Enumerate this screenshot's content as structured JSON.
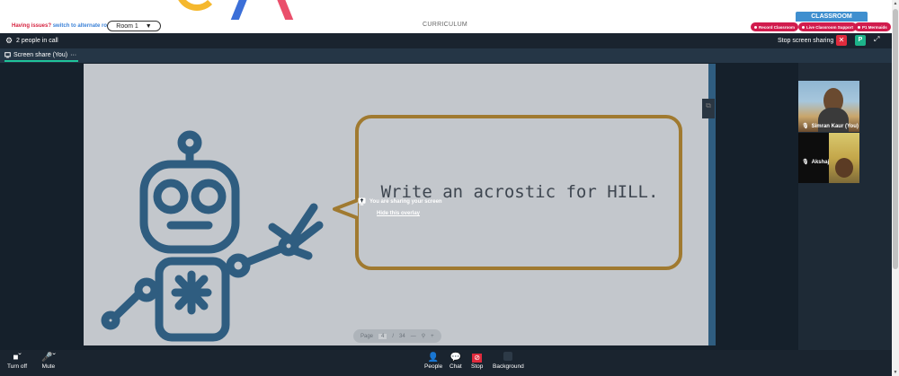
{
  "topbar": {
    "issues_text": "Having issues?",
    "alt_room_link": "switch to alternate room",
    "room_selected": "Room 1",
    "room_caret": "▼",
    "curriculum": "CURRICULUM",
    "classroom_tab": "CLASSROOM",
    "pills": [
      "Record Classroom",
      "Live Classroom Support",
      "P1 Mermaids"
    ]
  },
  "callbar": {
    "people_count": "2 people in call",
    "stop_sharing": "Stop screen sharing",
    "stop_x": "✕",
    "p_label": "P"
  },
  "tab": {
    "label": "Screen share (You)",
    "more": "···"
  },
  "slide": {
    "text": "Write an acrostic for HILL.",
    "pager_page_label": "Page",
    "pager_page": "4",
    "pager_sep": "/",
    "pager_total": "34"
  },
  "overlay": {
    "message": "You are sharing your screen",
    "hide_link": "Hide this overlay"
  },
  "participants": [
    {
      "name": "Simran Kaur (You)"
    },
    {
      "name": "Akshaj"
    }
  ],
  "controls": {
    "turn_off": "Turn off",
    "mute": "Mute",
    "people": "People",
    "chat": "Chat",
    "stop": "Stop",
    "background": "Background"
  },
  "colors": {
    "accent_red": "#d11b4d",
    "accent_green": "#1db48a",
    "classroom_blue": "#3f8fcf",
    "robot_blue": "#2f5d80",
    "bubble_gold": "#a07a30"
  }
}
